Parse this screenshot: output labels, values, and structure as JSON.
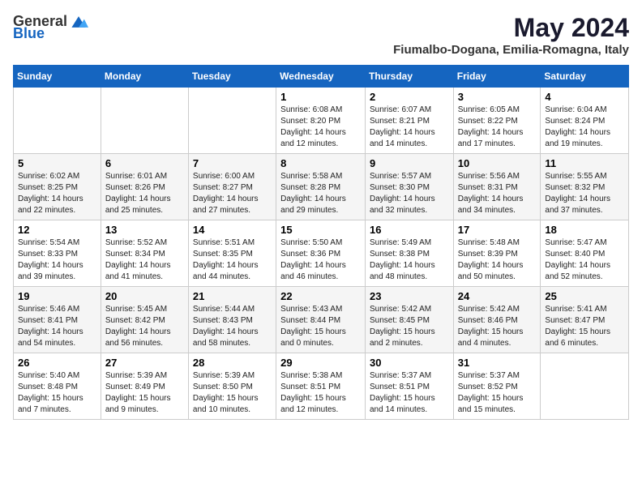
{
  "header": {
    "logo_general": "General",
    "logo_blue": "Blue",
    "title": "May 2024",
    "subtitle": "Fiumalbo-Dogana, Emilia-Romagna, Italy"
  },
  "columns": [
    "Sunday",
    "Monday",
    "Tuesday",
    "Wednesday",
    "Thursday",
    "Friday",
    "Saturday"
  ],
  "weeks": [
    [
      {
        "day": "",
        "sunrise": "",
        "sunset": "",
        "daylight": ""
      },
      {
        "day": "",
        "sunrise": "",
        "sunset": "",
        "daylight": ""
      },
      {
        "day": "",
        "sunrise": "",
        "sunset": "",
        "daylight": ""
      },
      {
        "day": "1",
        "sunrise": "Sunrise: 6:08 AM",
        "sunset": "Sunset: 8:20 PM",
        "daylight": "Daylight: 14 hours and 12 minutes."
      },
      {
        "day": "2",
        "sunrise": "Sunrise: 6:07 AM",
        "sunset": "Sunset: 8:21 PM",
        "daylight": "Daylight: 14 hours and 14 minutes."
      },
      {
        "day": "3",
        "sunrise": "Sunrise: 6:05 AM",
        "sunset": "Sunset: 8:22 PM",
        "daylight": "Daylight: 14 hours and 17 minutes."
      },
      {
        "day": "4",
        "sunrise": "Sunrise: 6:04 AM",
        "sunset": "Sunset: 8:24 PM",
        "daylight": "Daylight: 14 hours and 19 minutes."
      }
    ],
    [
      {
        "day": "5",
        "sunrise": "Sunrise: 6:02 AM",
        "sunset": "Sunset: 8:25 PM",
        "daylight": "Daylight: 14 hours and 22 minutes."
      },
      {
        "day": "6",
        "sunrise": "Sunrise: 6:01 AM",
        "sunset": "Sunset: 8:26 PM",
        "daylight": "Daylight: 14 hours and 25 minutes."
      },
      {
        "day": "7",
        "sunrise": "Sunrise: 6:00 AM",
        "sunset": "Sunset: 8:27 PM",
        "daylight": "Daylight: 14 hours and 27 minutes."
      },
      {
        "day": "8",
        "sunrise": "Sunrise: 5:58 AM",
        "sunset": "Sunset: 8:28 PM",
        "daylight": "Daylight: 14 hours and 29 minutes."
      },
      {
        "day": "9",
        "sunrise": "Sunrise: 5:57 AM",
        "sunset": "Sunset: 8:30 PM",
        "daylight": "Daylight: 14 hours and 32 minutes."
      },
      {
        "day": "10",
        "sunrise": "Sunrise: 5:56 AM",
        "sunset": "Sunset: 8:31 PM",
        "daylight": "Daylight: 14 hours and 34 minutes."
      },
      {
        "day": "11",
        "sunrise": "Sunrise: 5:55 AM",
        "sunset": "Sunset: 8:32 PM",
        "daylight": "Daylight: 14 hours and 37 minutes."
      }
    ],
    [
      {
        "day": "12",
        "sunrise": "Sunrise: 5:54 AM",
        "sunset": "Sunset: 8:33 PM",
        "daylight": "Daylight: 14 hours and 39 minutes."
      },
      {
        "day": "13",
        "sunrise": "Sunrise: 5:52 AM",
        "sunset": "Sunset: 8:34 PM",
        "daylight": "Daylight: 14 hours and 41 minutes."
      },
      {
        "day": "14",
        "sunrise": "Sunrise: 5:51 AM",
        "sunset": "Sunset: 8:35 PM",
        "daylight": "Daylight: 14 hours and 44 minutes."
      },
      {
        "day": "15",
        "sunrise": "Sunrise: 5:50 AM",
        "sunset": "Sunset: 8:36 PM",
        "daylight": "Daylight: 14 hours and 46 minutes."
      },
      {
        "day": "16",
        "sunrise": "Sunrise: 5:49 AM",
        "sunset": "Sunset: 8:38 PM",
        "daylight": "Daylight: 14 hours and 48 minutes."
      },
      {
        "day": "17",
        "sunrise": "Sunrise: 5:48 AM",
        "sunset": "Sunset: 8:39 PM",
        "daylight": "Daylight: 14 hours and 50 minutes."
      },
      {
        "day": "18",
        "sunrise": "Sunrise: 5:47 AM",
        "sunset": "Sunset: 8:40 PM",
        "daylight": "Daylight: 14 hours and 52 minutes."
      }
    ],
    [
      {
        "day": "19",
        "sunrise": "Sunrise: 5:46 AM",
        "sunset": "Sunset: 8:41 PM",
        "daylight": "Daylight: 14 hours and 54 minutes."
      },
      {
        "day": "20",
        "sunrise": "Sunrise: 5:45 AM",
        "sunset": "Sunset: 8:42 PM",
        "daylight": "Daylight: 14 hours and 56 minutes."
      },
      {
        "day": "21",
        "sunrise": "Sunrise: 5:44 AM",
        "sunset": "Sunset: 8:43 PM",
        "daylight": "Daylight: 14 hours and 58 minutes."
      },
      {
        "day": "22",
        "sunrise": "Sunrise: 5:43 AM",
        "sunset": "Sunset: 8:44 PM",
        "daylight": "Daylight: 15 hours and 0 minutes."
      },
      {
        "day": "23",
        "sunrise": "Sunrise: 5:42 AM",
        "sunset": "Sunset: 8:45 PM",
        "daylight": "Daylight: 15 hours and 2 minutes."
      },
      {
        "day": "24",
        "sunrise": "Sunrise: 5:42 AM",
        "sunset": "Sunset: 8:46 PM",
        "daylight": "Daylight: 15 hours and 4 minutes."
      },
      {
        "day": "25",
        "sunrise": "Sunrise: 5:41 AM",
        "sunset": "Sunset: 8:47 PM",
        "daylight": "Daylight: 15 hours and 6 minutes."
      }
    ],
    [
      {
        "day": "26",
        "sunrise": "Sunrise: 5:40 AM",
        "sunset": "Sunset: 8:48 PM",
        "daylight": "Daylight: 15 hours and 7 minutes."
      },
      {
        "day": "27",
        "sunrise": "Sunrise: 5:39 AM",
        "sunset": "Sunset: 8:49 PM",
        "daylight": "Daylight: 15 hours and 9 minutes."
      },
      {
        "day": "28",
        "sunrise": "Sunrise: 5:39 AM",
        "sunset": "Sunset: 8:50 PM",
        "daylight": "Daylight: 15 hours and 10 minutes."
      },
      {
        "day": "29",
        "sunrise": "Sunrise: 5:38 AM",
        "sunset": "Sunset: 8:51 PM",
        "daylight": "Daylight: 15 hours and 12 minutes."
      },
      {
        "day": "30",
        "sunrise": "Sunrise: 5:37 AM",
        "sunset": "Sunset: 8:51 PM",
        "daylight": "Daylight: 15 hours and 14 minutes."
      },
      {
        "day": "31",
        "sunrise": "Sunrise: 5:37 AM",
        "sunset": "Sunset: 8:52 PM",
        "daylight": "Daylight: 15 hours and 15 minutes."
      },
      {
        "day": "",
        "sunrise": "",
        "sunset": "",
        "daylight": ""
      }
    ]
  ]
}
